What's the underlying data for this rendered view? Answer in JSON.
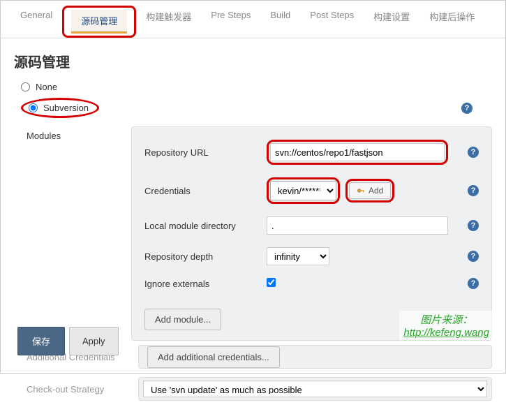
{
  "tabs": [
    "General",
    "源码管理",
    "构建触发器",
    "Pre Steps",
    "Build",
    "Post Steps",
    "构建设置",
    "构建后操作"
  ],
  "activeTab": 1,
  "sectionTitle": "源码管理",
  "scm": {
    "noneLabel": "None",
    "subversionLabel": "Subversion"
  },
  "modulesLabel": "Modules",
  "form": {
    "repoUrlLabel": "Repository URL",
    "repoUrlValue": "svn://centos/repo1/fastjson",
    "credentialsLabel": "Credentials",
    "credentialsValue": "kevin/******",
    "addBtnLabel": "Add",
    "localDirLabel": "Local module directory",
    "localDirValue": ".",
    "depthLabel": "Repository depth",
    "depthValue": "infinity",
    "ignoreExtLabel": "Ignore externals",
    "addModuleLabel": "Add module..."
  },
  "lower": {
    "addlCredLabel": "Additional Credentials",
    "addlCredBtn": "Add additional credentials...",
    "strategyLabel": "Check-out Strategy",
    "strategyValue": "Use 'svn update' as much as possible"
  },
  "footer": {
    "save": "保存",
    "apply": "Apply"
  },
  "watermark": {
    "line1": "图片来源：",
    "line2": "http://kefeng.wang"
  },
  "helpGlyph": "?"
}
